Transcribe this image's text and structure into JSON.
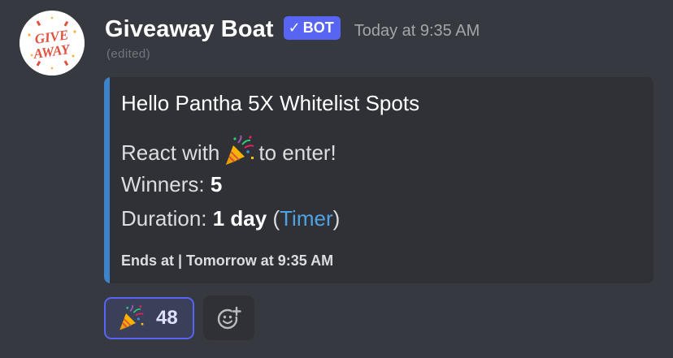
{
  "message": {
    "author": {
      "username": "Giveaway Boat",
      "bot_tag": "BOT",
      "avatar_text": [
        "GIVE",
        "AWAY"
      ]
    },
    "timestamp": "Today at 9:35 AM",
    "edited_label": "(edited)",
    "embed": {
      "accent_color": "#3e82c8",
      "title": "Hello Pantha 5X Whitelist Spots",
      "react_prefix": "React with",
      "react_emoji": "party-popper-icon",
      "react_suffix": "to enter!",
      "winners_label": "Winners:",
      "winners_value": "5",
      "duration_label": "Duration:",
      "duration_value": "1 day",
      "timer_open": "(",
      "timer_link": "Timer",
      "timer_close": ")",
      "footer": "Ends at | Tomorrow at 9:35 AM"
    },
    "reactions": [
      {
        "emoji": "party-popper-icon",
        "count": "48",
        "reacted": true
      }
    ],
    "add_reaction_icon": "add-reaction-icon"
  },
  "colors": {
    "background": "#36393f",
    "embed_background": "#2f3136",
    "blurple": "#5865f2",
    "link": "#4fa3e3",
    "avatar_text": "#e0523f"
  }
}
